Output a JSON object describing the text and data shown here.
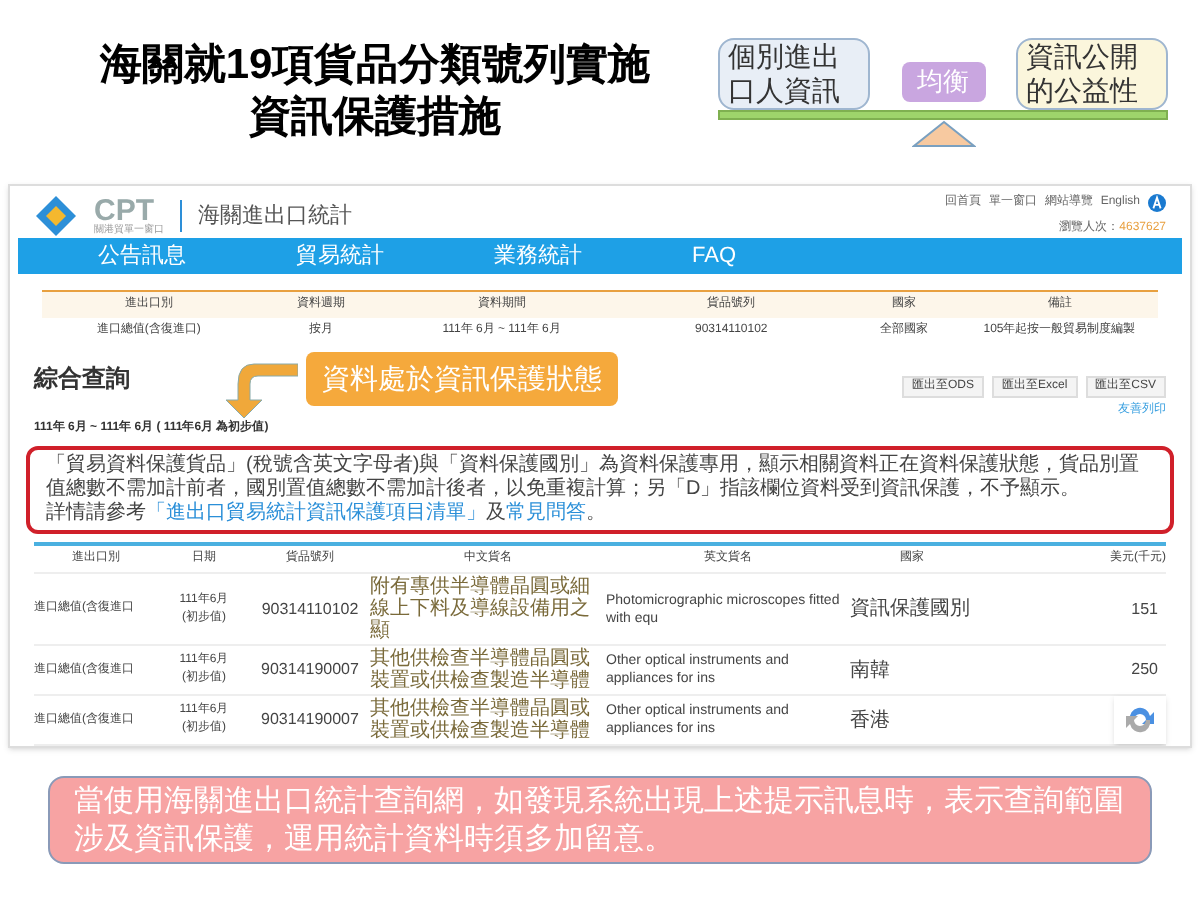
{
  "slide_title": [
    "海關就19項貨品分類號列實施",
    "資訊保護措施"
  ],
  "balance": {
    "left": "個別進出口人資訊",
    "center": "均衡",
    "right": "資訊公開的公益性"
  },
  "site": {
    "logo": "CPT",
    "logo_subtitle": "關港貿單一窗口",
    "title": "海關進出口統計",
    "top_links": [
      "回首頁",
      "單一窗口",
      "網站導覽",
      "English"
    ],
    "visitors_label": "瀏覽人次：",
    "visitors": "4637627",
    "nav": [
      {
        "label": "公告訊息",
        "selected": false
      },
      {
        "label": "貿易統計",
        "selected": false
      },
      {
        "label": "業務統計",
        "selected": false
      },
      {
        "label": "FAQ",
        "selected": false
      }
    ],
    "summary": {
      "columns": [
        "進出口別",
        "資料週期",
        "資料期間",
        "貨品號列",
        "國家",
        "備註"
      ],
      "row": [
        "進口總值(含復進口)",
        "按月",
        "111年 6月 ~ 111年 6月",
        "90314110102",
        "全部國家",
        "105年起按一般貿易制度編製"
      ]
    },
    "section_title": "綜合查詢",
    "callout": "資料處於資訊保護狀態",
    "exports": [
      "匯出至ODS",
      "匯出至Excel",
      "匯出至CSV"
    ],
    "print_link": "友善列印",
    "period": "111年 6月 ~ 111年 6月 ( 111年6月 為初步值)",
    "notice": {
      "text": "「貿易資料保護貨品」(稅號含英文字母者)與「資料保護國別」為資料保護專用，顯示相關資料正在資料保護狀態，貨品別置值總數不需加計前者，國別置值總數不需加計後者，以免重複計算；另「D」指該欄位資料受到資訊保護，不予顯示。",
      "more_prefix": "詳情請參考",
      "link1": "「進出口貿易統計資訊保護項目清單」",
      "middle": "及",
      "link2": "常見問答",
      "end": "。"
    },
    "results": {
      "columns": [
        "進出口別",
        "日期",
        "貨品號列",
        "中文貨名",
        "英文貨名",
        "國家",
        "美元(千元)"
      ],
      "rows": [
        {
          "flow": "進口總值(含復進口",
          "date": "111年6月",
          "note": "(初步值)",
          "code": "90314110102",
          "name_zh": "附有專供半導體晶圓或細線上下料及導線設備用之顯",
          "name_en": "Photomicrographic microscopes fitted with equ",
          "country": "資訊保護國別",
          "usd": "151"
        },
        {
          "flow": "進口總值(含復進口",
          "date": "111年6月",
          "note": "(初步值)",
          "code": "90314190007",
          "name_zh": "其他供檢查半導體晶圓或裝置或供檢查製造半導體",
          "name_en": "Other optical instruments and appliances for ins",
          "country": "南韓",
          "usd": "250"
        },
        {
          "flow": "進口總值(含復進口",
          "date": "111年6月",
          "note": "(初步值)",
          "code": "90314190007",
          "name_zh": "其他供檢查半導體晶圓或裝置或供檢查製造半導體",
          "name_en": "Other optical instruments and appliances for ins",
          "country": "香港"
        }
      ]
    }
  },
  "footer_note": "當使用海關進出口統計查詢網，如發現系統出現上述提示訊息時，表示查詢範圍涉及資訊保護，運用統計資料時須多加留意。"
}
